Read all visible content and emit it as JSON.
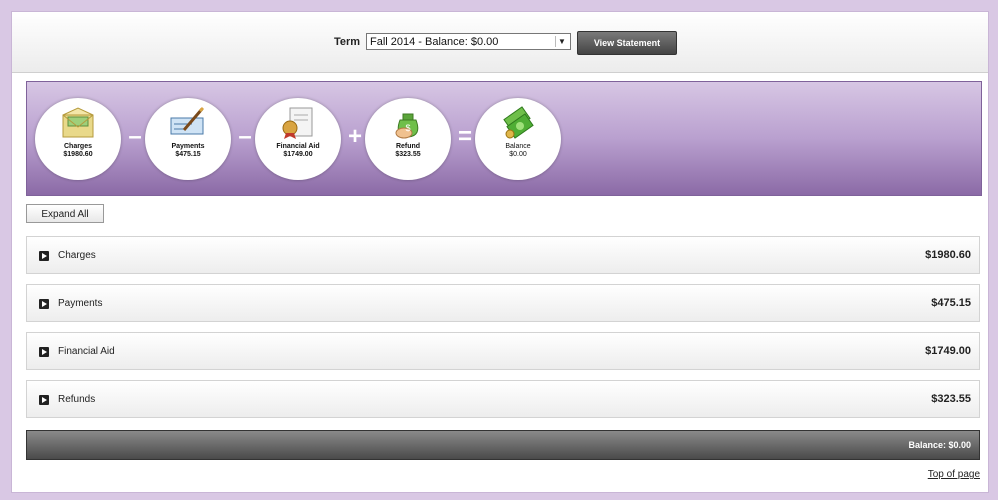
{
  "term": {
    "label": "Term",
    "selected": "Fall 2014 - Balance: $0.00",
    "view_button": "View Statement"
  },
  "equation": {
    "items": [
      {
        "name": "Charges",
        "amount": "$1980.60",
        "icon": "envelope-money-icon"
      },
      {
        "name": "Payments",
        "amount": "$475.15",
        "icon": "check-pen-icon"
      },
      {
        "name": "Financial Aid",
        "amount": "$1749.00",
        "icon": "certificate-seal-icon"
      },
      {
        "name": "Refund",
        "amount": "$323.55",
        "icon": "money-bag-icon"
      },
      {
        "name": "Balance",
        "amount": "$0.00",
        "icon": "cash-stack-icon"
      }
    ],
    "operators": [
      "–",
      "–",
      "+",
      "="
    ]
  },
  "expand_all": "Expand All",
  "rows": [
    {
      "label": "Charges",
      "amount": "$1980.60"
    },
    {
      "label": "Payments",
      "amount": "$475.15"
    },
    {
      "label": "Financial Aid",
      "amount": "$1749.00"
    },
    {
      "label": "Refunds",
      "amount": "$323.55"
    }
  ],
  "balance_total": "Balance: $0.00",
  "top_of_page": "Top of page",
  "colors": {
    "band_top": "#d7c6e4",
    "band_bottom": "#8b6aa6",
    "page_bg": "#d9c8e4"
  }
}
